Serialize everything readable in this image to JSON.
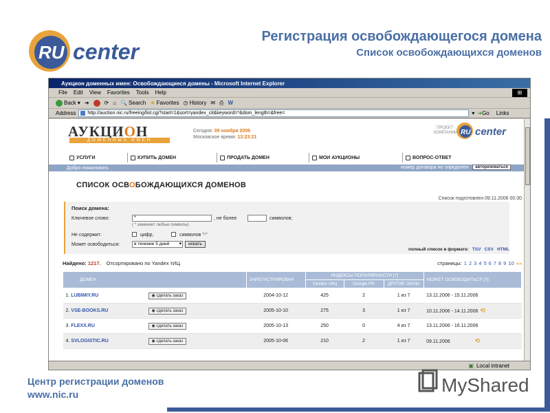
{
  "slide": {
    "title": "Регистрация освобождающегося домена",
    "subtitle": "Список освобождающихся доменов",
    "logo_text": "RU center",
    "footer_org": "Центр регистрации доменов",
    "footer_url": "www.nic.ru",
    "watermark": "MyShared",
    "accent_color": "#4a6fa5",
    "bar_color": "#3b5a99"
  },
  "browser": {
    "title": "Аукцион доменных имен: Освобождающиеся домены - Microsoft Internet Explorer",
    "menu": [
      "File",
      "Edit",
      "View",
      "Favorites",
      "Tools",
      "Help"
    ],
    "toolbar": {
      "back": "Back",
      "search": "Search",
      "favorites": "Favorites",
      "history": "History"
    },
    "address_label": "Address",
    "address_value": "http://auction.nic.ru/freeing/list.cgi?start=1&sort=yandex_cit&keyword=*&dom_length=&free=",
    "go_label": "Go",
    "links_label": "Links",
    "status_zone": "Local intranet"
  },
  "site": {
    "logo": "АУКЦИ",
    "logo_o": "О",
    "logo_end": "Н",
    "logo_sub": "ДОМЕННЫХ ИМЕН",
    "today_label": "Сегодня:",
    "today_value": "09 ноября 2006",
    "moscow_label": "Московское время:",
    "moscow_value": "13:23:21",
    "project_label": "ПРОЕКТ КОМПАНИИ",
    "project_logo": "RU center",
    "nav": [
      "УСЛУГИ",
      "КУПИТЬ ДОМЕН",
      "ПРОДАТЬ ДОМЕН",
      "МОИ АУКЦИОНЫ",
      "ВОПРОС-ОТВЕТ"
    ],
    "welcome": "Добро пожаловать",
    "contract": "номер договора не определен",
    "login": "авторизоваться",
    "heading_a": "СПИСОК ОСВ",
    "heading_o": "О",
    "heading_b": "БОЖДАЮЩИХСЯ ДОМЕНОВ",
    "prepared": "Список подготовлен 09.11.2006 00:30"
  },
  "search": {
    "title": "Поиск домена:",
    "keyword_label": "Ключевое слово:",
    "keyword_value": "*",
    "hint": "( * заменяет любые символы)",
    "no_more_label": ", не более",
    "symbols_label": "символов;",
    "exclude_label": "Не содержит:",
    "digits_label": "цифр,",
    "dash_label": "символов \"-\"",
    "free_label": "Может освободиться:",
    "free_value": "в течение 5 дней",
    "search_button": "искать",
    "full_list_label": "полный список в формате:",
    "formats": [
      "TSV",
      "CSV",
      "HTML"
    ]
  },
  "results": {
    "found_label": "Найдено:",
    "found_count": "1217.",
    "sorted": "Отсортировано по Yandex тИЦ",
    "pages_label": "страницы:",
    "pages": [
      "1",
      "2",
      "3",
      "4",
      "5",
      "6",
      "7",
      "8",
      "9",
      "10"
    ],
    "next": "»»"
  },
  "table": {
    "headers": {
      "domain": "ДОМЕН",
      "registered": "ЗАРЕГИСТРИРОВАН",
      "popularity": "ИНДЕКСЫ ПОПУЛЯРНОСТИ [?]",
      "yandex": "Yandex тИЦ",
      "google": "Google PR",
      "zones": "ДРУГИЕ ЗОНЫ",
      "free": "МОЖЕТ ОСВОБОДИТЬСЯ [?]"
    },
    "order_label": "сделать заказ",
    "rows": [
      {
        "num": "1.",
        "domain": "LUBIMIY.RU",
        "registered": "2004-10-12",
        "yandex": "425",
        "google": "2",
        "zones": "1 из 7",
        "free": "13.11.2006 - 15.11.2006",
        "refresh": false
      },
      {
        "num": "2.",
        "domain": "VSE-BOOKS.RU",
        "registered": "2005-10-10",
        "yandex": "275",
        "google": "3",
        "zones": "1 из 7",
        "free": "10.11.2006 - 14.11.2006",
        "refresh": true
      },
      {
        "num": "3.",
        "domain": "FLEXX.RU",
        "registered": "2005-10-13",
        "yandex": "250",
        "google": "0",
        "zones": "4 из 7",
        "free": "13.11.2006 - 16.11.2006",
        "refresh": false
      },
      {
        "num": "4.",
        "domain": "SVLOGISTIC.RU",
        "registered": "2005-10-06",
        "yandex": "210",
        "google": "2",
        "zones": "1 из 7",
        "free": "09.11.2006",
        "refresh": true
      }
    ]
  }
}
